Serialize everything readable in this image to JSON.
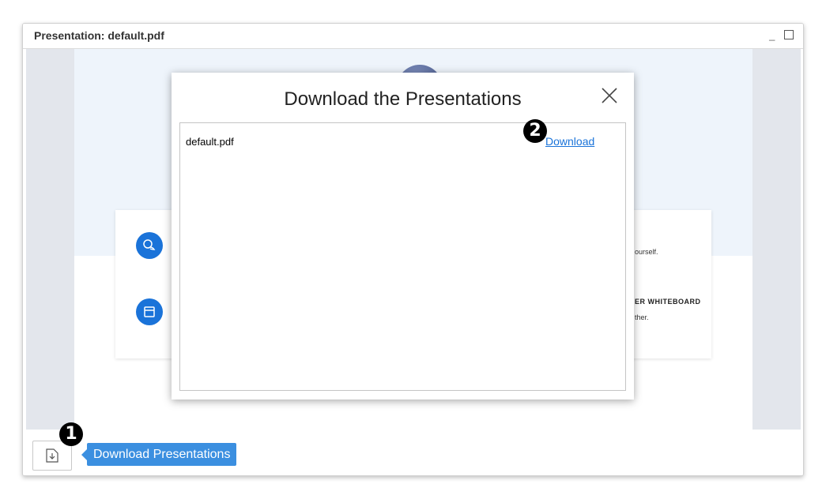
{
  "window": {
    "title": "Presentation: default.pdf",
    "minimize_label": "_"
  },
  "slide": {
    "feature_1_text": "ourself.",
    "feature_2_heading": "ER WHITEBOARD",
    "feature_2_text": "ther."
  },
  "toolbar": {
    "download_icon": "download-file-icon",
    "tooltip": "Download Presentations"
  },
  "annotations": {
    "step_1": "1",
    "step_2": "2"
  },
  "modal": {
    "title": "Download the Presentations",
    "close_icon": "close-icon",
    "files": [
      {
        "name": "default.pdf",
        "action": "Download"
      }
    ]
  },
  "colors": {
    "accent": "#1a73d9",
    "tooltip": "#3b8fe0",
    "viewer_bg": "#e3e6ec"
  }
}
